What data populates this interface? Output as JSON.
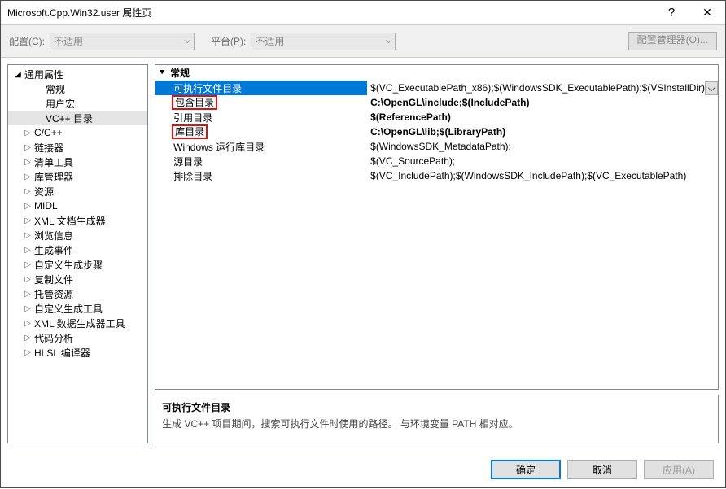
{
  "window": {
    "title": "Microsoft.Cpp.Win32.user 属性页",
    "help": "?",
    "close": "✕"
  },
  "configbar": {
    "config_label": "配置(C):",
    "config_value": "不适用",
    "platform_label": "平台(P):",
    "platform_value": "不适用",
    "manager_button": "配置管理器(O)..."
  },
  "tree": {
    "root": "通用属性",
    "items": [
      {
        "label": "常规",
        "expandable": false
      },
      {
        "label": "用户宏",
        "expandable": false
      },
      {
        "label": "VC++ 目录",
        "expandable": false,
        "selected": true
      },
      {
        "label": "C/C++",
        "expandable": true
      },
      {
        "label": "链接器",
        "expandable": true
      },
      {
        "label": "清单工具",
        "expandable": true
      },
      {
        "label": "库管理器",
        "expandable": true
      },
      {
        "label": "资源",
        "expandable": true
      },
      {
        "label": "MIDL",
        "expandable": true
      },
      {
        "label": "XML 文档生成器",
        "expandable": true
      },
      {
        "label": "浏览信息",
        "expandable": true
      },
      {
        "label": "生成事件",
        "expandable": true
      },
      {
        "label": "自定义生成步骤",
        "expandable": true
      },
      {
        "label": "复制文件",
        "expandable": true
      },
      {
        "label": "托管资源",
        "expandable": true
      },
      {
        "label": "自定义生成工具",
        "expandable": true
      },
      {
        "label": "XML 数据生成器工具",
        "expandable": true
      },
      {
        "label": "代码分析",
        "expandable": true
      },
      {
        "label": "HLSL 编译器",
        "expandable": true
      }
    ]
  },
  "grid": {
    "category": "常规",
    "rows": [
      {
        "name": "可执行文件目录",
        "value": "$(VC_ExecutablePath_x86);$(WindowsSDK_ExecutablePath);$(VSInstallDir)",
        "selected": true,
        "bold": false,
        "highlight": false,
        "dropdown": true
      },
      {
        "name": "包含目录",
        "value": "C:\\OpenGL\\include;$(IncludePath)",
        "bold": true,
        "highlight": true
      },
      {
        "name": "引用目录",
        "value": "$(ReferencePath)",
        "bold": true
      },
      {
        "name": "库目录",
        "value": "C:\\OpenGL\\lib;$(LibraryPath)",
        "bold": true,
        "highlight": true
      },
      {
        "name": "Windows 运行库目录",
        "value": "$(WindowsSDK_MetadataPath);"
      },
      {
        "name": "源目录",
        "value": "$(VC_SourcePath);"
      },
      {
        "name": "排除目录",
        "value": "$(VC_IncludePath);$(WindowsSDK_IncludePath);$(VC_ExecutablePath)"
      }
    ]
  },
  "description": {
    "title": "可执行文件目录",
    "text": "生成 VC++ 项目期间，搜索可执行文件时使用的路径。   与环境变量 PATH 相对应。"
  },
  "footer": {
    "ok": "确定",
    "cancel": "取消",
    "apply": "应用(A)"
  }
}
